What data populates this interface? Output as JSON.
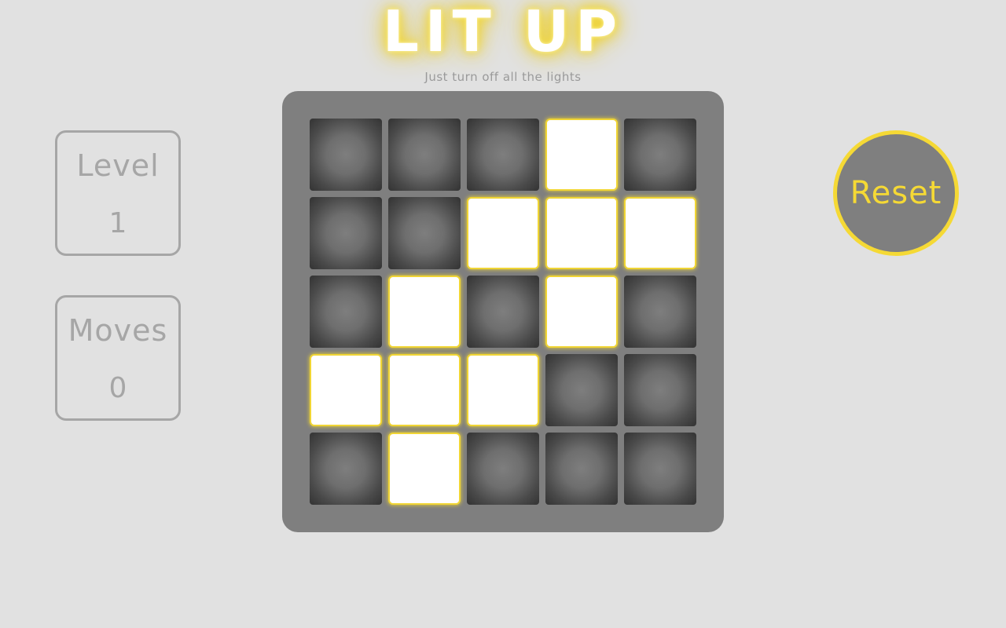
{
  "header": {
    "title": "LIT UP",
    "subtitle": "Just turn off all the lights"
  },
  "stats": {
    "level_label": "Level",
    "level_value": "1",
    "moves_label": "Moves",
    "moves_value": "0"
  },
  "board": {
    "size": 5,
    "lights": [
      [
        0,
        0,
        0,
        1,
        0
      ],
      [
        0,
        0,
        1,
        1,
        1
      ],
      [
        0,
        1,
        0,
        1,
        0
      ],
      [
        1,
        1,
        1,
        0,
        0
      ],
      [
        0,
        1,
        0,
        0,
        0
      ]
    ]
  },
  "controls": {
    "reset_label": "Reset"
  },
  "colors": {
    "background": "#e1e1e1",
    "board": "#7f7f7f",
    "accent": "#f5d935",
    "light_on": "#ffffff",
    "muted_text": "#a6a6a6"
  }
}
